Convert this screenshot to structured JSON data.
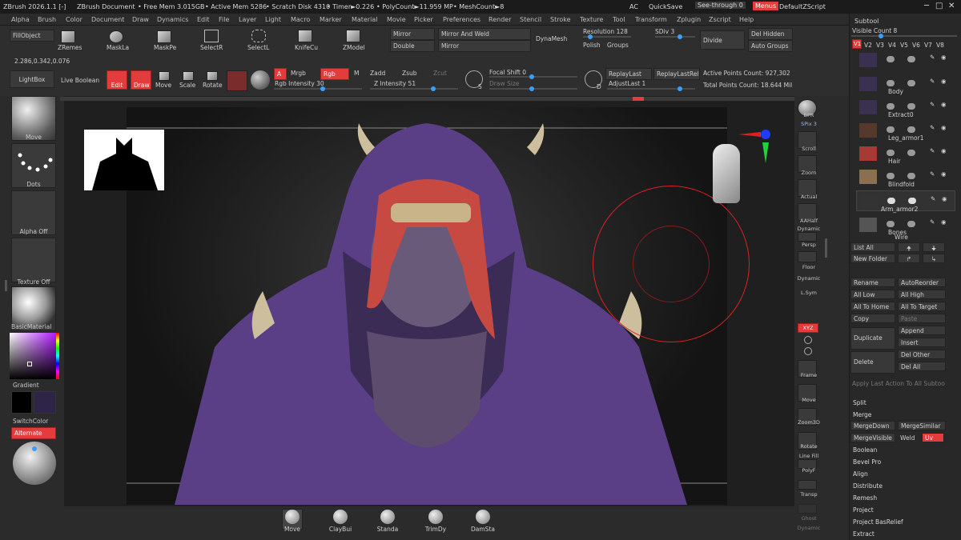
{
  "titlebar": {
    "app": "ZBrush 2026.1.1 [-]",
    "doc": "ZBrush Document",
    "free_mem": "• Free Mem 3.015GB",
    "active_mem": "• Active Mem 5286",
    "scratch": "• Scratch Disk 4310",
    "timer": "• Timer►0.226",
    "polycount": "• PolyCount►11.959 MP",
    "meshcount": "• MeshCount►8",
    "ac": "AC",
    "quicksave": "QuickSave",
    "seethrough": "See-through  0",
    "menus": "Menus",
    "script": "DefaultZScript"
  },
  "menu": [
    "Alpha",
    "Brush",
    "Color",
    "Document",
    "Draw",
    "Dynamics",
    "Edit",
    "File",
    "Layer",
    "Light",
    "Macro",
    "Marker",
    "Material",
    "Movie",
    "Picker",
    "Preferences",
    "Render",
    "Stencil",
    "Stroke",
    "Texture",
    "Tool",
    "Transform",
    "Zplugin",
    "Zscript",
    "Help"
  ],
  "toolbar": {
    "fillobject": "FillObject",
    "coords": "2.286,0.342,0.076",
    "zremesh": "ZRemes",
    "maskla": "MaskLa",
    "maskpe": "MaskPe",
    "selectr": "SelectR",
    "selectl": "SelectL",
    "knifecu": "KnifeCu",
    "zmodel": "ZModel",
    "mirror": "Mirror",
    "mirror_weld": "Mirror And Weld",
    "double": "Double",
    "mirror2": "Mirror",
    "dynamesh": "DynaMesh",
    "resolution": "Resolution 128",
    "sdiv": "SDiv 3",
    "divide": "Divide",
    "del_hidden": "Del Hidden",
    "polish": "Polish",
    "groups": "Groups",
    "auto_groups": "Auto Groups",
    "lightbox": "LightBox",
    "live_boolean": "Live Boolean",
    "edit": "Edit",
    "draw": "Draw",
    "move": "Move",
    "scale": "Scale",
    "rotate": "Rotate",
    "a": "A",
    "mrgb": "Mrgb",
    "rgb": "Rgb",
    "m": "M",
    "rgb_intensity": "Rgb Intensity 30",
    "zadd": "Zadd",
    "zsub": "Zsub",
    "zcut": "Zcut",
    "z_intensity": "Z Intensity 51",
    "focal_shift": "Focal Shift 0",
    "draw_size": "Draw Size",
    "s": "S",
    "d": "D",
    "replaylast": "ReplayLast",
    "replaylastrel": "ReplayLastRel",
    "adjustlast": "AdjustLast 1",
    "active_points": "Active Points Count: 927,302",
    "total_points": "Total Points Count: 18.644 Mil"
  },
  "leftshelf": {
    "move": "Move",
    "dots": "Dots",
    "alpha": "Alpha Off",
    "texture": "Texture Off",
    "material": "BasicMaterial",
    "gradient": "Gradient",
    "switchcolor": "SwitchColor",
    "alternate": "Alternate"
  },
  "rightshelf": [
    "BPR",
    "SPix 3",
    "Scroll",
    "Zoom",
    "Actual",
    "AAHalf",
    "Dynamic",
    "Persp",
    "Floor",
    "Dynamic",
    "L.Sym",
    "XYZ",
    "Frame",
    "Move",
    "Zoom3D",
    "Rotate",
    "Line Fill",
    "PolyF",
    "Transp",
    "Ghost",
    "Dynamic"
  ],
  "bottom": [
    "Move",
    "ClayBui",
    "Standa",
    "TrimDy",
    "DamSta"
  ],
  "subtool": {
    "title": "Subtool",
    "visible_count": "Visible Count 8",
    "versions": [
      "V1",
      "V2",
      "V3",
      "V4",
      "V5",
      "V6",
      "V7",
      "V8"
    ],
    "items": [
      "",
      "Body",
      "Extract0",
      "Leg_armor1",
      "Hair",
      "Blindfold",
      "Arm_armor2",
      "Bones",
      "Wire"
    ],
    "list_all": "List All",
    "new_folder": "New Folder",
    "rename": "Rename",
    "autoreorder": "AutoReorder",
    "all_low": "All Low",
    "all_high": "All High",
    "all_to_home": "All To Home",
    "all_to_target": "All To Target",
    "copy": "Copy",
    "paste": "Paste",
    "duplicate": "Duplicate",
    "append": "Append",
    "insert": "Insert",
    "delete": "Delete",
    "del_other": "Del Other",
    "del_all": "Del All",
    "apply_last": "Apply Last Action To All Subtoo",
    "split": "Split",
    "merge": "Merge",
    "mergedown": "MergeDown",
    "mergesimilar": "MergeSimilar",
    "mergevisible": "MergeVisible",
    "weld": "Weld",
    "uv": "Uv",
    "boolean": "Boolean",
    "bevel_pro": "Bevel Pro",
    "align": "Align",
    "distribute": "Distribute",
    "remesh": "Remesh",
    "project": "Project",
    "project_basrelief": "Project BasRelief",
    "extract": "Extract"
  },
  "colors": {
    "accent_red": "#e33c3c",
    "slider_blue": "#3aa0ff",
    "hood": "#5a3f86",
    "hair": "#c64a42",
    "skin": "#6a5a7a"
  }
}
